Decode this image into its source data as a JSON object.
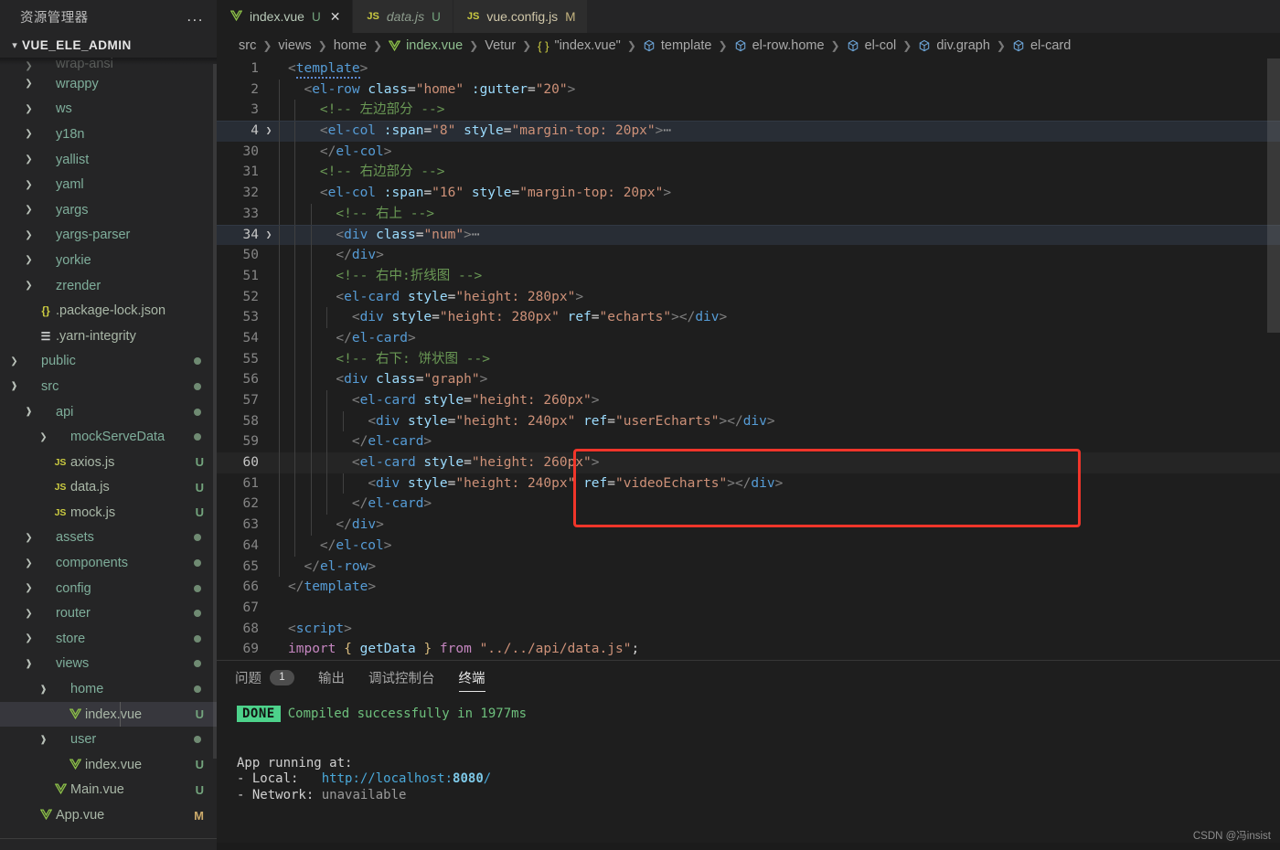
{
  "sidebar": {
    "title": "资源管理器",
    "more_label": "...",
    "root": "VUE_ELE_ADMIN",
    "items": [
      {
        "indent": 1,
        "twist": "closed",
        "icon": "",
        "label": "wrap-ansi",
        "badge": "",
        "dot": false,
        "faded": true,
        "kind": "folder"
      },
      {
        "indent": 1,
        "twist": "closed",
        "icon": "",
        "label": "wrappy",
        "badge": "",
        "dot": false,
        "faded": false,
        "kind": "folder"
      },
      {
        "indent": 1,
        "twist": "closed",
        "icon": "",
        "label": "ws",
        "badge": "",
        "dot": false,
        "faded": false,
        "kind": "folder"
      },
      {
        "indent": 1,
        "twist": "closed",
        "icon": "",
        "label": "y18n",
        "badge": "",
        "dot": false,
        "faded": false,
        "kind": "folder"
      },
      {
        "indent": 1,
        "twist": "closed",
        "icon": "",
        "label": "yallist",
        "badge": "",
        "dot": false,
        "faded": false,
        "kind": "folder"
      },
      {
        "indent": 1,
        "twist": "closed",
        "icon": "",
        "label": "yaml",
        "badge": "",
        "dot": false,
        "faded": false,
        "kind": "folder"
      },
      {
        "indent": 1,
        "twist": "closed",
        "icon": "",
        "label": "yargs",
        "badge": "",
        "dot": false,
        "faded": false,
        "kind": "folder"
      },
      {
        "indent": 1,
        "twist": "closed",
        "icon": "",
        "label": "yargs-parser",
        "badge": "",
        "dot": false,
        "faded": false,
        "kind": "folder"
      },
      {
        "indent": 1,
        "twist": "closed",
        "icon": "",
        "label": "yorkie",
        "badge": "",
        "dot": false,
        "faded": false,
        "kind": "folder"
      },
      {
        "indent": 1,
        "twist": "closed",
        "icon": "",
        "label": "zrender",
        "badge": "",
        "dot": false,
        "faded": false,
        "kind": "folder"
      },
      {
        "indent": 1,
        "twist": "none",
        "icon": "json-icon",
        "label": ".package-lock.json",
        "badge": "",
        "dot": false,
        "faded": false,
        "kind": "file"
      },
      {
        "indent": 1,
        "twist": "none",
        "icon": "text-icon",
        "label": ".yarn-integrity",
        "badge": "",
        "dot": false,
        "faded": false,
        "kind": "file"
      },
      {
        "indent": 0,
        "twist": "closed",
        "icon": "",
        "label": "public",
        "badge": "",
        "dot": true,
        "faded": false,
        "kind": "folder"
      },
      {
        "indent": 0,
        "twist": "open",
        "icon": "",
        "label": "src",
        "badge": "",
        "dot": true,
        "faded": false,
        "kind": "folder"
      },
      {
        "indent": 1,
        "twist": "open",
        "icon": "",
        "label": "api",
        "badge": "",
        "dot": true,
        "faded": false,
        "kind": "folder"
      },
      {
        "indent": 2,
        "twist": "closed",
        "icon": "",
        "label": "mockServeData",
        "badge": "",
        "dot": true,
        "faded": false,
        "kind": "folder"
      },
      {
        "indent": 2,
        "twist": "none",
        "icon": "js-icon",
        "label": "axios.js",
        "badge": "U",
        "dot": false,
        "faded": false,
        "kind": "file"
      },
      {
        "indent": 2,
        "twist": "none",
        "icon": "js-icon",
        "label": "data.js",
        "badge": "U",
        "dot": false,
        "faded": false,
        "kind": "file"
      },
      {
        "indent": 2,
        "twist": "none",
        "icon": "js-icon",
        "label": "mock.js",
        "badge": "U",
        "dot": false,
        "faded": false,
        "kind": "file"
      },
      {
        "indent": 1,
        "twist": "closed",
        "icon": "",
        "label": "assets",
        "badge": "",
        "dot": true,
        "faded": false,
        "kind": "folder"
      },
      {
        "indent": 1,
        "twist": "closed",
        "icon": "",
        "label": "components",
        "badge": "",
        "dot": true,
        "faded": false,
        "kind": "folder"
      },
      {
        "indent": 1,
        "twist": "closed",
        "icon": "",
        "label": "config",
        "badge": "",
        "dot": true,
        "faded": false,
        "kind": "folder"
      },
      {
        "indent": 1,
        "twist": "closed",
        "icon": "",
        "label": "router",
        "badge": "",
        "dot": true,
        "faded": false,
        "kind": "folder"
      },
      {
        "indent": 1,
        "twist": "closed",
        "icon": "",
        "label": "store",
        "badge": "",
        "dot": true,
        "faded": false,
        "kind": "folder"
      },
      {
        "indent": 1,
        "twist": "open",
        "icon": "",
        "label": "views",
        "badge": "",
        "dot": true,
        "faded": false,
        "kind": "folder"
      },
      {
        "indent": 2,
        "twist": "open",
        "icon": "",
        "label": "home",
        "badge": "",
        "dot": true,
        "faded": false,
        "kind": "folder"
      },
      {
        "indent": 3,
        "twist": "none",
        "icon": "vue-icon",
        "label": "index.vue",
        "badge": "U",
        "dot": false,
        "faded": false,
        "kind": "file",
        "selected": true
      },
      {
        "indent": 2,
        "twist": "open",
        "icon": "",
        "label": "user",
        "badge": "",
        "dot": true,
        "faded": false,
        "kind": "folder"
      },
      {
        "indent": 3,
        "twist": "none",
        "icon": "vue-icon",
        "label": "index.vue",
        "badge": "U",
        "dot": false,
        "faded": false,
        "kind": "file"
      },
      {
        "indent": 2,
        "twist": "none",
        "icon": "vue-icon",
        "label": "Main.vue",
        "badge": "U",
        "dot": false,
        "faded": false,
        "kind": "file"
      },
      {
        "indent": 1,
        "twist": "none",
        "icon": "vue-icon",
        "label": "App.vue",
        "badge": "M",
        "dot": false,
        "faded": false,
        "kind": "file"
      }
    ]
  },
  "tabs": [
    {
      "icon": "vue-icon",
      "label": "index.vue",
      "status": "U",
      "active": true,
      "preview": false,
      "closable": true
    },
    {
      "icon": "js-icon",
      "label": "data.js",
      "status": "U",
      "active": false,
      "preview": true,
      "closable": false
    },
    {
      "icon": "js-icon",
      "label": "vue.config.js",
      "status": "M",
      "active": false,
      "preview": false,
      "closable": false
    }
  ],
  "breadcrumbs": [
    {
      "label": "src",
      "icon": "none"
    },
    {
      "label": "views",
      "icon": "none"
    },
    {
      "label": "home",
      "icon": "none"
    },
    {
      "label": "index.vue",
      "icon": "vue-icon"
    },
    {
      "label": "Vetur",
      "icon": "none"
    },
    {
      "label": "\"index.vue\"",
      "icon": "braces-icon"
    },
    {
      "label": "template",
      "icon": "cube-icon"
    },
    {
      "label": "el-row.home",
      "icon": "cube-icon"
    },
    {
      "label": "el-col",
      "icon": "cube-icon"
    },
    {
      "label": "div.graph",
      "icon": "cube-icon"
    },
    {
      "label": "el-card",
      "icon": "cube-icon"
    }
  ],
  "editor": {
    "language": "vue",
    "lines": [
      {
        "n": "1",
        "fold": "",
        "state": "normal"
      },
      {
        "n": "2",
        "fold": "",
        "state": "normal"
      },
      {
        "n": "3",
        "fold": "",
        "state": "normal"
      },
      {
        "n": "4",
        "fold": ">",
        "state": "highlight"
      },
      {
        "n": "30",
        "fold": "",
        "state": "normal"
      },
      {
        "n": "31",
        "fold": "",
        "state": "normal"
      },
      {
        "n": "32",
        "fold": "",
        "state": "normal"
      },
      {
        "n": "33",
        "fold": "",
        "state": "normal"
      },
      {
        "n": "34",
        "fold": ">",
        "state": "highlight"
      },
      {
        "n": "50",
        "fold": "",
        "state": "normal"
      },
      {
        "n": "51",
        "fold": "",
        "state": "normal"
      },
      {
        "n": "52",
        "fold": "",
        "state": "normal"
      },
      {
        "n": "53",
        "fold": "",
        "state": "normal"
      },
      {
        "n": "54",
        "fold": "",
        "state": "normal"
      },
      {
        "n": "55",
        "fold": "",
        "state": "normal"
      },
      {
        "n": "56",
        "fold": "",
        "state": "normal"
      },
      {
        "n": "57",
        "fold": "",
        "state": "normal"
      },
      {
        "n": "58",
        "fold": "",
        "state": "normal"
      },
      {
        "n": "59",
        "fold": "",
        "state": "normal"
      },
      {
        "n": "60",
        "fold": "",
        "state": "current"
      },
      {
        "n": "61",
        "fold": "",
        "state": "normal"
      },
      {
        "n": "62",
        "fold": "",
        "state": "normal"
      },
      {
        "n": "63",
        "fold": "",
        "state": "normal"
      },
      {
        "n": "64",
        "fold": "",
        "state": "normal"
      },
      {
        "n": "65",
        "fold": "",
        "state": "normal"
      },
      {
        "n": "66",
        "fold": "",
        "state": "normal"
      },
      {
        "n": "67",
        "fold": "",
        "state": "normal"
      },
      {
        "n": "68",
        "fold": "",
        "state": "normal"
      },
      {
        "n": "69",
        "fold": "",
        "state": "normal"
      }
    ],
    "source": [
      "<template>",
      "  <el-row class=\"home\" :gutter=\"20\">",
      "    <!-- 左边部分 -->",
      "    <el-col :span=\"8\" style=\"margin-top: 20px\">⋯",
      "    </el-col>",
      "    <!-- 右边部分 -->",
      "    <el-col :span=\"16\" style=\"margin-top: 20px\">",
      "      <!-- 右上 -->",
      "      <div class=\"num\">⋯",
      "      </div>",
      "      <!-- 右中:折线图 -->",
      "      <el-card style=\"height: 280px\">",
      "        <div style=\"height: 280px\" ref=\"echarts\"></div>",
      "      </el-card>",
      "      <!-- 右下: 饼状图 -->",
      "      <div class=\"graph\">",
      "        <el-card style=\"height: 260px\">",
      "          <div style=\"height: 240px\" ref=\"userEcharts\"></div>",
      "        </el-card>",
      "        <el-card style=\"height: 260px\">",
      "          <div style=\"height: 240px\" ref=\"videoEcharts\"></div>",
      "        </el-card>",
      "      </div>",
      "    </el-col>",
      "  </el-row>",
      "</template>",
      "",
      "<script>",
      "import { getData } from \"../../api/data.js\";"
    ],
    "annotation": {
      "type": "red-rectangle",
      "covers_lines": [
        "57",
        "58",
        "59"
      ],
      "color": "#f0352a"
    }
  },
  "panel": {
    "tabs": [
      {
        "label": "问题",
        "badge": "1",
        "active": false
      },
      {
        "label": "输出",
        "badge": "",
        "active": false
      },
      {
        "label": "调试控制台",
        "badge": "",
        "active": false
      },
      {
        "label": "终端",
        "badge": "",
        "active": true
      }
    ],
    "terminal": {
      "status_chip": "DONE",
      "status_message": "Compiled successfully in 1977ms",
      "heading": "App running at:",
      "local_label": "- Local:",
      "local_url_prefix": "http://localhost:",
      "local_url_port": "8080",
      "local_url_suffix": "/",
      "network_label": "- Network:",
      "network_value": "unavailable"
    }
  },
  "watermark": "CSDN @冯insist",
  "colors": {
    "accent_red": "#f0352a",
    "editor_bg": "#1e1e1e",
    "sidebar_bg": "#252526",
    "tag": "#569cd6",
    "attribute": "#9cdcfe",
    "string": "#ce9178",
    "comment": "#6a9955",
    "keyword": "#c586c0",
    "done_chip": "#4dd28b"
  }
}
